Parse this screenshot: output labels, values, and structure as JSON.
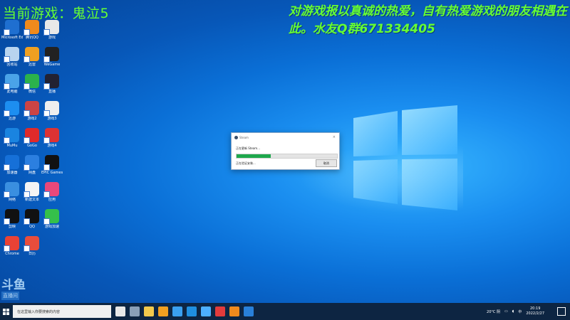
{
  "overlay": {
    "left_text": "当前游戏：鬼泣5",
    "right_text": "对游戏报以真诚的热爱，自有热爱游戏的朋友相遇在此。水友Q群671334405"
  },
  "desktop_icons": [
    {
      "label": "Microsoft Edge",
      "color": "#1f6fd0"
    },
    {
      "label": "腾讯QQ",
      "color": "#f08a1c"
    },
    {
      "label": "游戏",
      "color": "#e8e8e8"
    },
    {
      "label": "回收站",
      "color": "#b8d4ef"
    },
    {
      "label": "迅雷",
      "color": "#f0a021"
    },
    {
      "label": "WeGame",
      "color": "#222"
    },
    {
      "label": "此电脑",
      "color": "#4aa3e8"
    },
    {
      "label": "微信",
      "color": "#2bb24c"
    },
    {
      "label": "直播",
      "color": "#223"
    },
    {
      "label": "迅游",
      "color": "#1d8ef0"
    },
    {
      "label": "游戏2",
      "color": "#c44"
    },
    {
      "label": "游戏3",
      "color": "#eee"
    },
    {
      "label": "MuMu",
      "color": "#1a84e0"
    },
    {
      "label": "GoGo",
      "color": "#e02a2a"
    },
    {
      "label": "游戏4",
      "color": "#d33"
    },
    {
      "label": "加速器",
      "color": "#1670d8"
    },
    {
      "label": "网盘",
      "color": "#2b7fe0"
    },
    {
      "label": "EPIC Games Launcher",
      "color": "#111"
    },
    {
      "label": "网络",
      "color": "#3a8fe0"
    },
    {
      "label": "新建文本",
      "color": "#f4f4f4"
    },
    {
      "label": "应用",
      "color": "#e9487a"
    },
    {
      "label": "剪映",
      "color": "#111"
    },
    {
      "label": "QQ",
      "color": "#111"
    },
    {
      "label": "游戏加速",
      "color": "#35c04a"
    },
    {
      "label": "Chrome",
      "color": "#e94235"
    },
    {
      "label": "日历",
      "color": "#e84d3c"
    }
  ],
  "dialog": {
    "title": "Steam",
    "status": "正在更新 Steam...",
    "progress": 0.34,
    "substatus": "正在验证安装...",
    "cancel_label": "取消",
    "close_label": "×"
  },
  "taskbar": {
    "search_placeholder": "在这里输入你要搜索的内容",
    "pinned": [
      "#e8e8e8",
      "#8aa0b8",
      "#f2c94c",
      "#f0a021",
      "#3aa0f0",
      "#1f8fe0",
      "#4db0ff",
      "#e23b3b",
      "#f08a1c",
      "#2980d9"
    ],
    "weather": "20°C 阴",
    "ime": "中",
    "time": "20:19",
    "date": "2022/2/27"
  },
  "watermark": {
    "main": "斗鱼",
    "sub": "直播间"
  }
}
